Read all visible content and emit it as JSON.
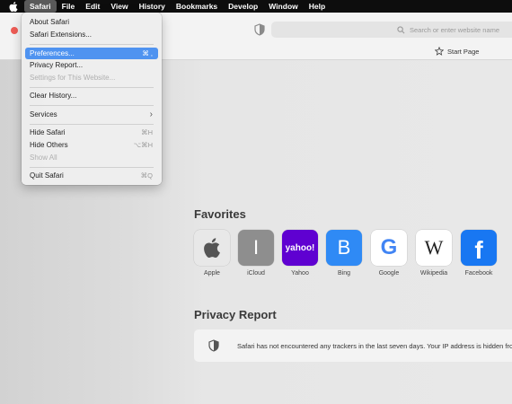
{
  "menubar": {
    "items": [
      "Safari",
      "File",
      "Edit",
      "View",
      "History",
      "Bookmarks",
      "Develop",
      "Window",
      "Help"
    ]
  },
  "menu": {
    "items": [
      {
        "label": "About Safari",
        "shortcut": ""
      },
      {
        "label": "Safari Extensions...",
        "shortcut": ""
      },
      {
        "label": "Preferences...",
        "shortcut": "⌘ ,"
      },
      {
        "label": "Privacy Report...",
        "shortcut": ""
      },
      {
        "label": "Settings for This Website...",
        "shortcut": ""
      },
      {
        "label": "Clear History...",
        "shortcut": ""
      },
      {
        "label": "Services",
        "shortcut": "›"
      },
      {
        "label": "Hide Safari",
        "shortcut": "⌘H"
      },
      {
        "label": "Hide Others",
        "shortcut": "⌥⌘H"
      },
      {
        "label": "Show All",
        "shortcut": ""
      },
      {
        "label": "Quit Safari",
        "shortcut": "⌘Q"
      }
    ]
  },
  "toolbar": {
    "search_placeholder": "Search or enter website name",
    "start_page": "Start Page"
  },
  "favorites": {
    "title": "Favorites",
    "items": [
      {
        "label": "Apple",
        "icon": "apple-logo",
        "bg": "#e8e8e8"
      },
      {
        "label": "iCloud",
        "icon": "letter-i",
        "bg": "#8e8e8e",
        "glyph": "I"
      },
      {
        "label": "Yahoo",
        "icon": "yahoo-logo",
        "bg": "#5f01d1",
        "glyph": "yahoo!"
      },
      {
        "label": "Bing",
        "icon": "letter-b",
        "bg": "#2f8af5",
        "glyph": "B"
      },
      {
        "label": "Google",
        "icon": "google-logo",
        "bg": "#ffffff",
        "glyph": "G"
      },
      {
        "label": "Wikipedia",
        "icon": "wikipedia-logo",
        "bg": "#ffffff",
        "glyph": "W"
      },
      {
        "label": "Facebook",
        "icon": "facebook-logo",
        "bg": "#1877f2",
        "glyph": "f"
      }
    ]
  },
  "privacy": {
    "title": "Privacy Report",
    "text": "Safari has not encountered any trackers in the last seven days. Your IP address is hidden from known trackers."
  }
}
